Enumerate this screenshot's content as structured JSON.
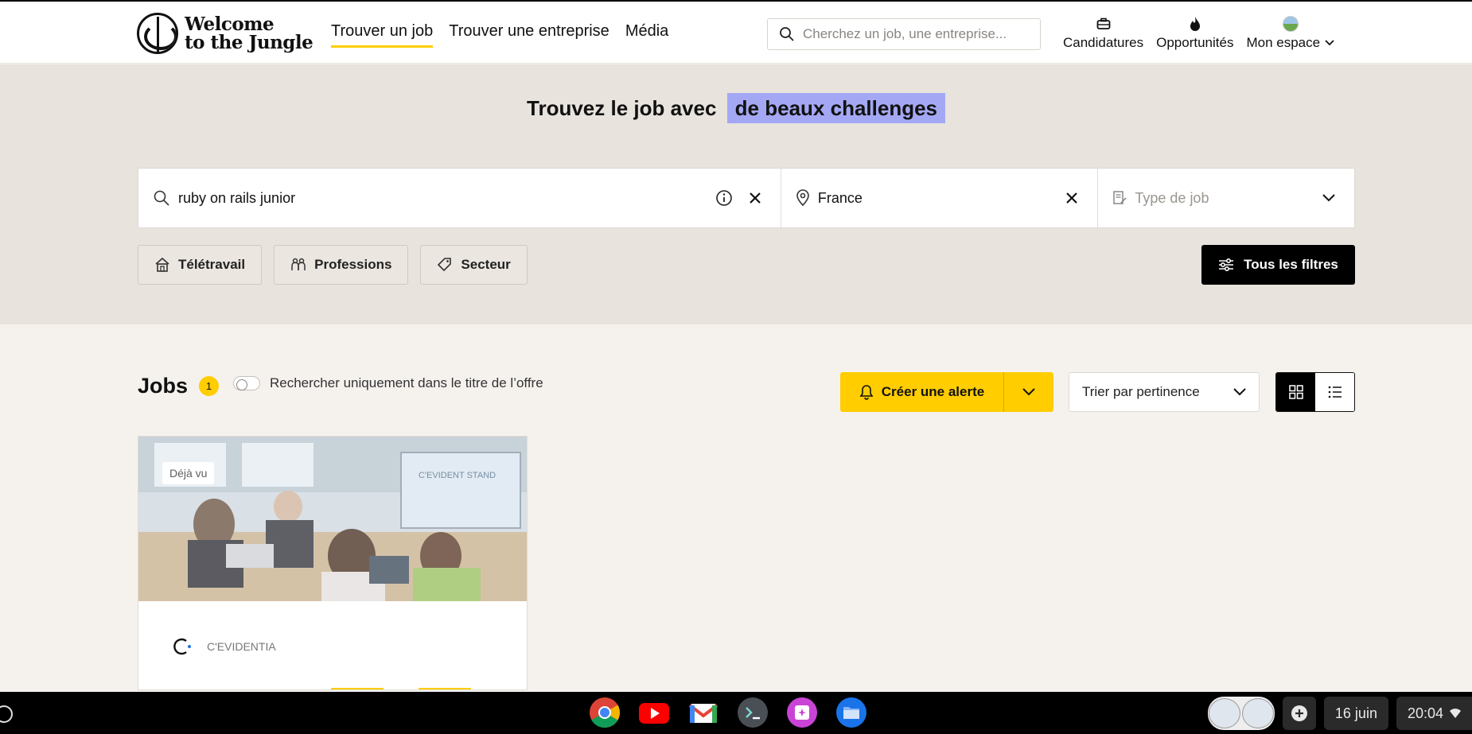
{
  "header": {
    "logo_line1": "Welcome",
    "logo_line2": "to the Jungle",
    "nav": [
      {
        "label": "Trouver un job"
      },
      {
        "label": "Trouver une entreprise"
      },
      {
        "label": "Média"
      }
    ],
    "search_placeholder": "Cherchez un job, une entreprise...",
    "links": {
      "applications": "Candidatures",
      "opportunities": "Opportunités",
      "my_space": "Mon espace"
    }
  },
  "hero": {
    "title_prefix": "Trouvez le job avec",
    "title_highlight": "de beaux challenges",
    "query_value": "ruby on rails junior",
    "location_value": "France",
    "job_type_placeholder": "Type de job",
    "filters": [
      {
        "label": "Télétravail"
      },
      {
        "label": "Professions"
      },
      {
        "label": "Secteur"
      }
    ],
    "all_filters": "Tous les filtres"
  },
  "results": {
    "title": "Jobs",
    "count": "1",
    "title_only_toggle": "Rechercher uniquement dans le titre de l’offre",
    "create_alert": "Créer une alerte",
    "sort_label": "Trier par pertinence"
  },
  "card": {
    "seen_badge": "Déjà vu",
    "company": "C'EVIDENTIA",
    "screen_text": "C'EVIDENT STAND"
  },
  "taskbar": {
    "date": "16 juin",
    "time": "20:04"
  },
  "colors": {
    "accent_yellow": "#ffcd00",
    "highlight_purple": "#a4a8f4",
    "hero_bg": "#e8e3dd",
    "page_bg": "#f5f2ee"
  }
}
